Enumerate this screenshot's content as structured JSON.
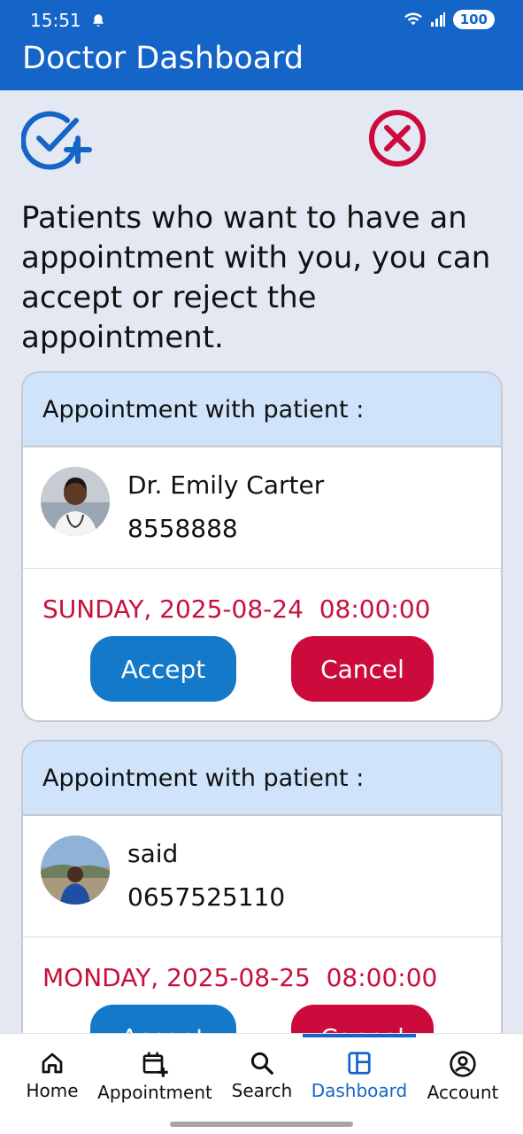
{
  "status_bar": {
    "time": "15:51",
    "battery": "100"
  },
  "header": {
    "title": "Doctor Dashboard"
  },
  "intro_text": "Patients who want to have an appointment with you, you can accept or reject the appointment.",
  "appointments": [
    {
      "heading": "Appointment with patient :",
      "name": "Dr. Emily Carter",
      "phone": "8558888",
      "datetime": "SUNDAY, 2025-08-24  08:00:00",
      "accept_label": "Accept",
      "cancel_label": "Cancel"
    },
    {
      "heading": "Appointment with patient :",
      "name": "said",
      "phone": "0657525110",
      "datetime": "MONDAY, 2025-08-25  08:00:00",
      "accept_label": "Accept",
      "cancel_label": "Cancel"
    }
  ],
  "bottom_nav": {
    "items": [
      {
        "label": "Home",
        "icon": "home-icon"
      },
      {
        "label": "Appointment",
        "icon": "calendar-add-icon"
      },
      {
        "label": "Search",
        "icon": "search-icon"
      },
      {
        "label": "Dashboard",
        "icon": "dashboard-icon"
      },
      {
        "label": "Account",
        "icon": "account-icon"
      }
    ],
    "active": "Dashboard"
  },
  "colors": {
    "primary": "#1565c8",
    "accept": "#1379c8",
    "reject": "#cc0a3c",
    "card_header": "#cfe3fb",
    "background": "#e3e8f2"
  }
}
